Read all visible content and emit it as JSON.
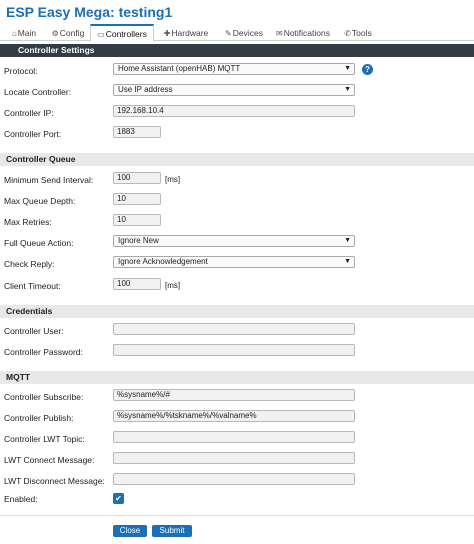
{
  "app": {
    "title": "ESP Easy Mega: testing1"
  },
  "tabs": [
    {
      "icon": "⌂",
      "label": "Main"
    },
    {
      "icon": "⚙",
      "label": "Config"
    },
    {
      "icon": "▭",
      "label": "Controllers"
    },
    {
      "icon": "✚",
      "label": "Hardware"
    },
    {
      "icon": "✎",
      "label": "Devices"
    },
    {
      "icon": "✉",
      "label": "Notifications"
    },
    {
      "icon": "✆",
      "label": "Tools"
    }
  ],
  "sections": {
    "settings": "Controller Settings",
    "queue": "Controller Queue",
    "credentials": "Credentials",
    "mqtt": "MQTT"
  },
  "settings": {
    "protocol": {
      "label": "Protocol:",
      "value": "Home Assistant (openHAB) MQTT"
    },
    "locate": {
      "label": "Locate Controller:",
      "value": "Use IP address"
    },
    "ip": {
      "label": "Controller IP:",
      "value": "192.168.10.4"
    },
    "port": {
      "label": "Controller Port:",
      "value": "1883"
    }
  },
  "queue": {
    "min_send": {
      "label": "Minimum Send Interval:",
      "value": "100",
      "unit": "[ms]"
    },
    "depth": {
      "label": "Max Queue Depth:",
      "value": "10"
    },
    "retries": {
      "label": "Max Retries:",
      "value": "10"
    },
    "full_action": {
      "label": "Full Queue Action:",
      "value": "Ignore New"
    },
    "check_reply": {
      "label": "Check Reply:",
      "value": "Ignore Acknowledgement"
    },
    "timeout": {
      "label": "Client Timeout:",
      "value": "100",
      "unit": "[ms]"
    }
  },
  "credentials": {
    "user": {
      "label": "Controller User:",
      "value": ""
    },
    "password": {
      "label": "Controller Password:",
      "value": ""
    }
  },
  "mqtt": {
    "subscribe": {
      "label": "Controller Subscribe:",
      "value": "%sysname%/#"
    },
    "publish": {
      "label": "Controller Publish:",
      "value": "%sysname%/%tskname%/%valname%"
    },
    "lwt_topic": {
      "label": "Controller LWT Topic:",
      "value": ""
    },
    "lwt_connect": {
      "label": "LWT Connect Message:",
      "value": ""
    },
    "lwt_disconnect": {
      "label": "LWT Disconnect Message:",
      "value": ""
    }
  },
  "enabled": {
    "label": "Enabled:",
    "checked": true
  },
  "buttons": {
    "close": "Close",
    "submit": "Submit"
  },
  "colors": {
    "accent": "#1a6fb5",
    "header_bar": "#343b44",
    "section_bar": "#e8e8e8"
  }
}
